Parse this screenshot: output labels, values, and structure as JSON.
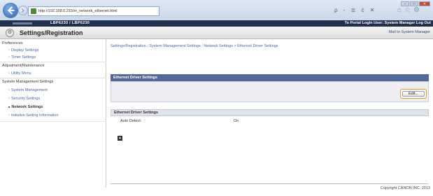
{
  "browser": {
    "url": "http://192.168.0.215/m_network_ethernet.html",
    "address_tools": "ρ - ≣ ċ ✕",
    "window_controls": {
      "minimize": "–",
      "maximize": "□",
      "close": "✕"
    }
  },
  "header": {
    "model": "LBP6230 / LBP6230",
    "portal_links": "To Portal   Login User: System Manager  Log Out",
    "page_title": "Settings/Registration",
    "mail_link": "Mail to System Manager"
  },
  "sidebar": {
    "items": [
      {
        "label": "Preferences",
        "kind": "category"
      },
      {
        "label": "Display Settings",
        "kind": "sub"
      },
      {
        "label": "Timer Settings",
        "kind": "sub"
      },
      {
        "label": "Adjustment/Maintenance",
        "kind": "category"
      },
      {
        "label": "Utility Menu",
        "kind": "sub"
      },
      {
        "label": "System Management Settings",
        "kind": "category"
      },
      {
        "label": "System Management",
        "kind": "sub"
      },
      {
        "label": "Security Settings",
        "kind": "sub"
      },
      {
        "label": "Network Settings",
        "kind": "sub",
        "active": true
      },
      {
        "label": "Initialize Setting Information",
        "kind": "sub"
      }
    ]
  },
  "main": {
    "breadcrumb": "Settings/Registration : System Management Settings : Network Settings > Ethernet Driver Settings",
    "section_title": "Ethernet Driver Settings",
    "edit_label": "Edit...",
    "info_title": "Ethernet Driver Settings",
    "rows": [
      {
        "label": "Auto Detect:",
        "value": "On"
      }
    ],
    "top_icon": "▲"
  },
  "footer": {
    "copyright": "Copyright CANON INC. 2013"
  },
  "colors": {
    "header_bar": "#1f2f4d",
    "section_head": "#4f6a95",
    "edit_highlight": "#e09a22",
    "link": "#4a66a0"
  },
  "icons": [
    "back-arrow-icon",
    "forward-arrow-icon",
    "site-icon",
    "settings-icon",
    "top-arrow-icon"
  ]
}
